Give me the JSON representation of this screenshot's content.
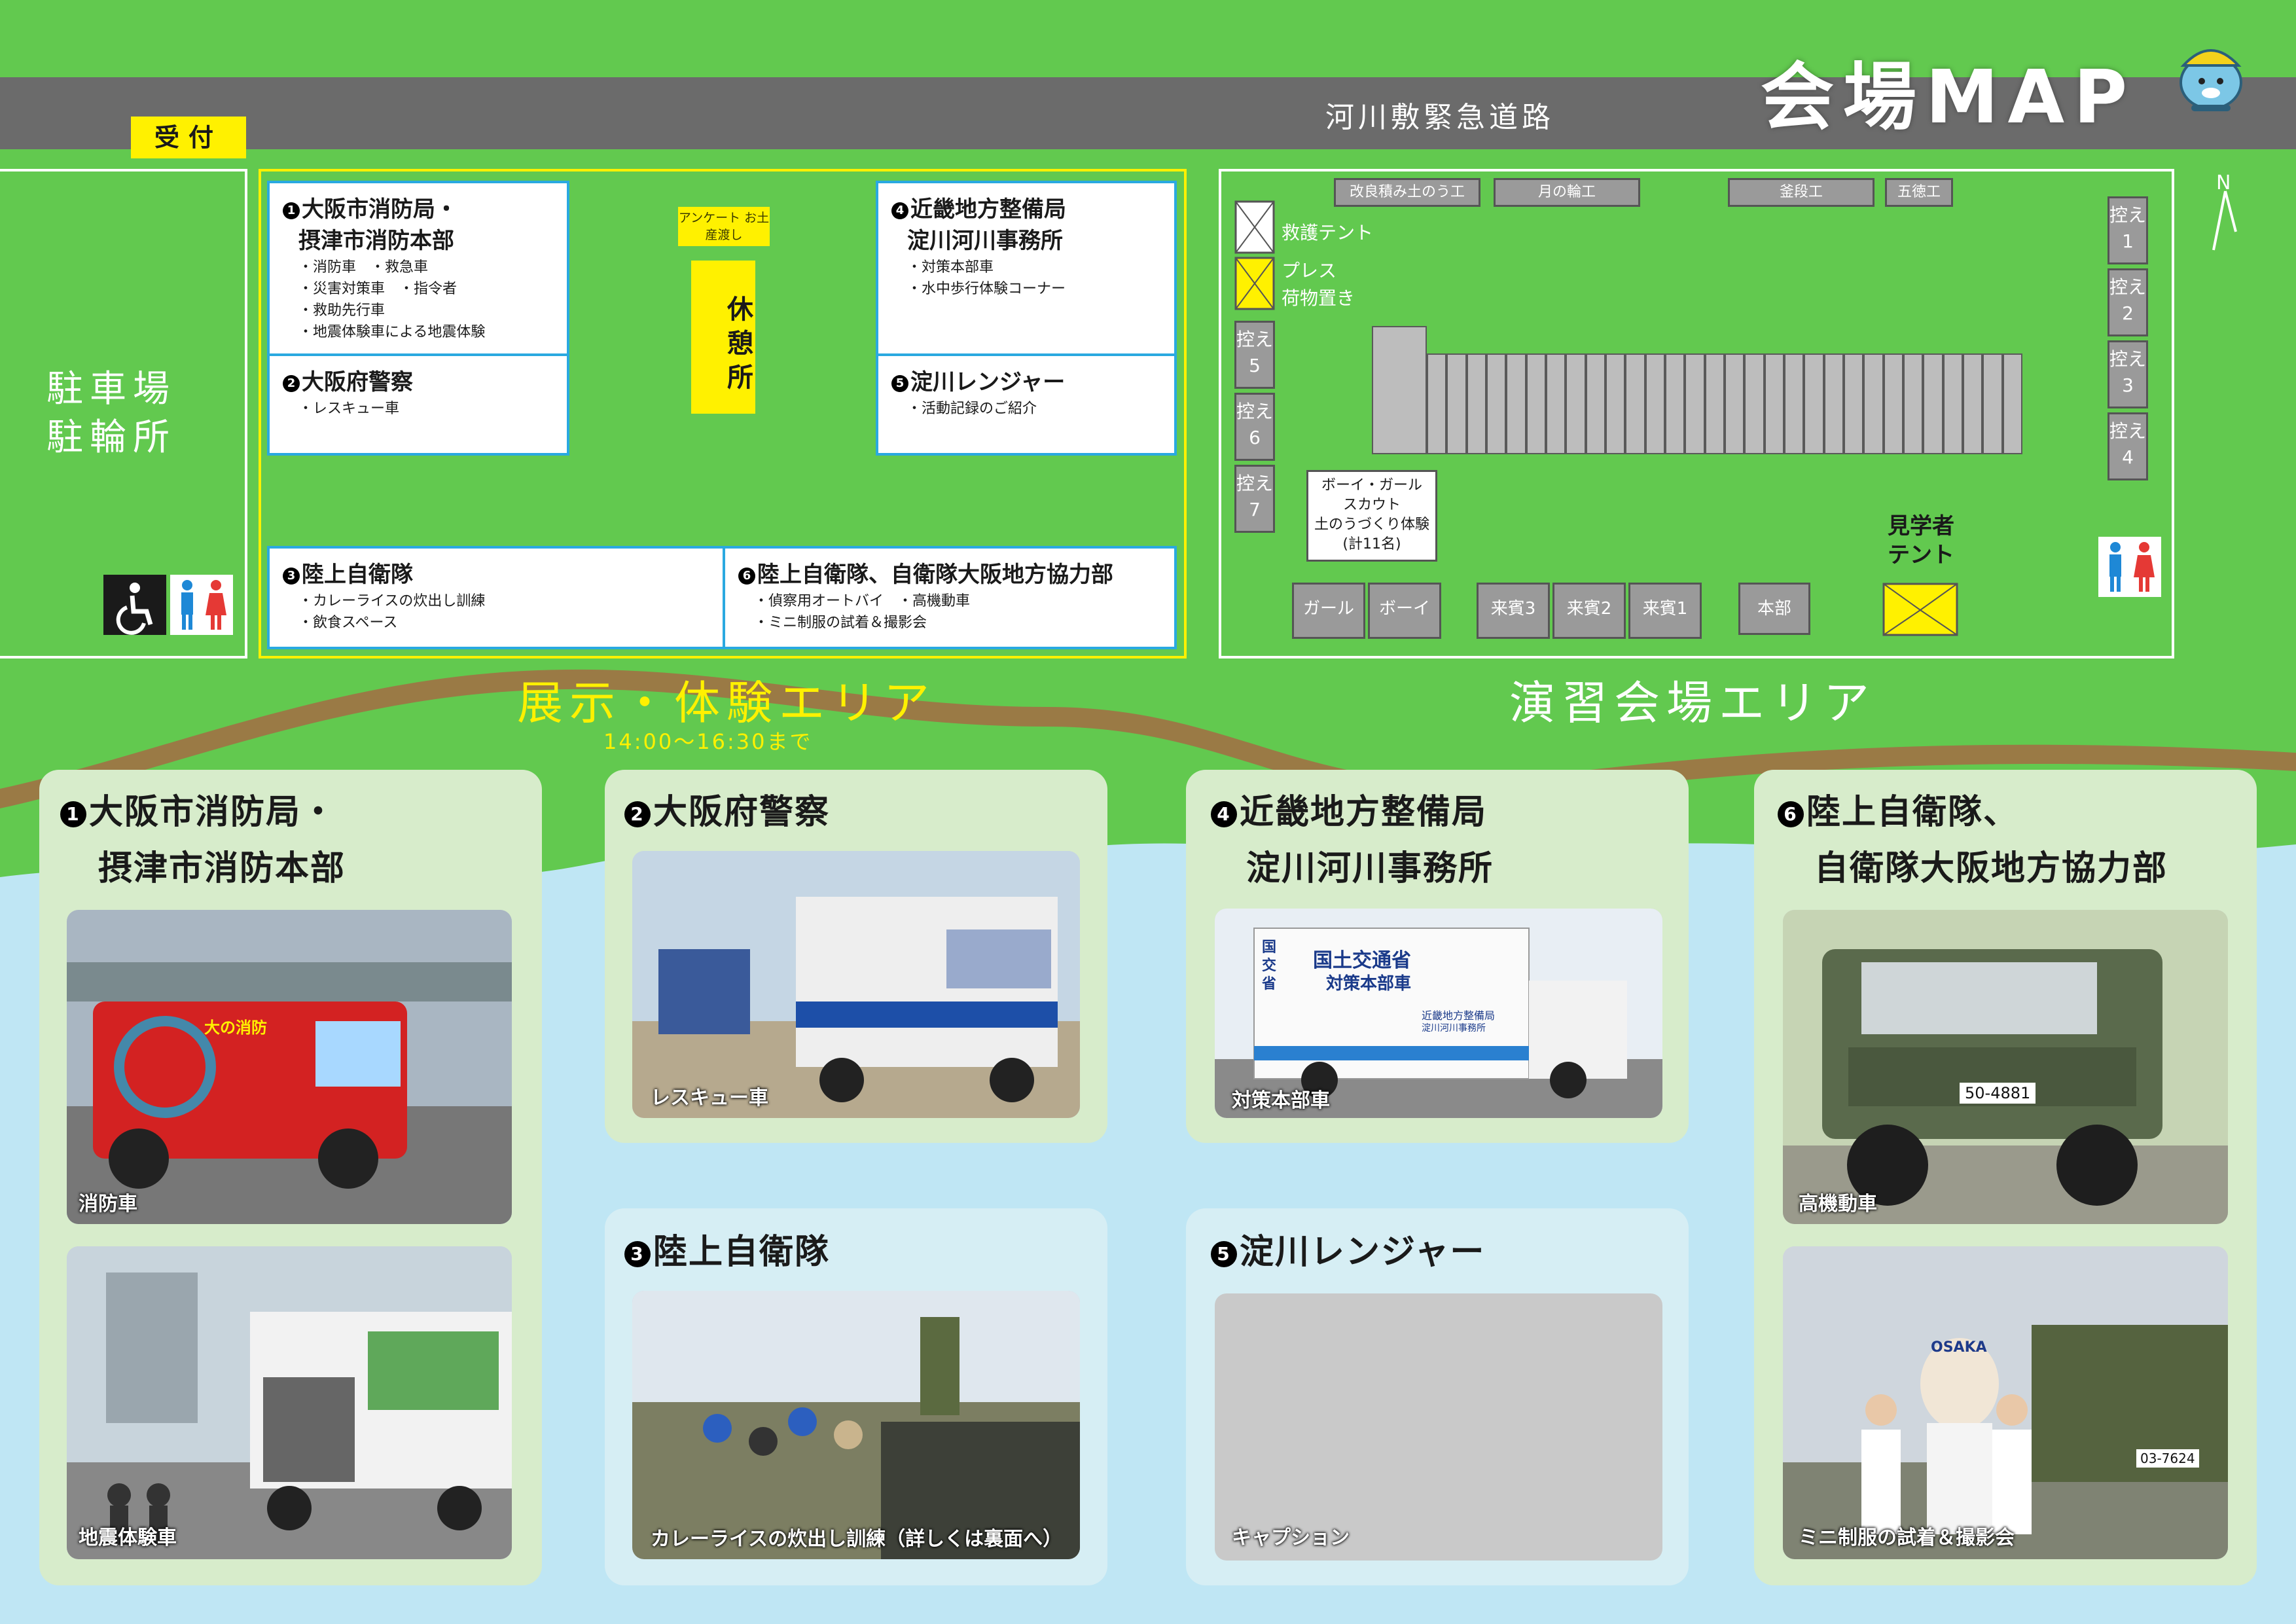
{
  "title": "会場MAP",
  "road": "河川敷緊急道路",
  "reception": "受付",
  "parking": {
    "line1": "駐車場",
    "line2": "駐輪所"
  },
  "compass": "N",
  "exhibit_area": {
    "title": "展示・体験エリア",
    "hours": "14:00〜16:30まで",
    "survey": "アンケート お土産渡し",
    "rest": "休憩所",
    "boxes": [
      {
        "num": "1",
        "name_l1": "大阪市消防局・",
        "name_l2": "摂津市消防本部",
        "details": [
          "・消防車　・救急車",
          "・災害対策車　・指令者",
          "・救助先行車",
          "・地震体験車による地震体験"
        ]
      },
      {
        "num": "2",
        "name_l1": "大阪府警察",
        "details": [
          "・レスキュー車"
        ]
      },
      {
        "num": "4",
        "name_l1": "近畿地方整備局",
        "name_l2": "淀川河川事務所",
        "details": [
          "・対策本部車",
          "・水中歩行体験コーナー"
        ]
      },
      {
        "num": "5",
        "name_l1": "淀川レンジャー",
        "details": [
          "・活動記録のご紹介"
        ]
      },
      {
        "num": "3",
        "name_l1": "陸上自衛隊",
        "details": [
          "・カレーライスの炊出し訓練",
          "・飲食スペース"
        ]
      },
      {
        "num": "6",
        "name_l1": "陸上自衛隊、自衛隊大阪地方協力部",
        "details": [
          "・偵察用オートバイ　・高機動車",
          "・ミニ制服の試着＆撮影会"
        ]
      }
    ]
  },
  "drill_area": {
    "title": "演習会場エリア",
    "top_labels": [
      "改良積み土のう工",
      "月の輪工",
      "釜段工",
      "五徳工"
    ],
    "rescue_tent": "救護テント",
    "press_l1": "プレス",
    "press_l2": "荷物置き",
    "ready_left": [
      "控え5",
      "控え6",
      "控え7"
    ],
    "ready_right": [
      "控え1",
      "控え2",
      "控え3",
      "控え4"
    ],
    "scout": {
      "l1": "ボーイ・ガール",
      "l2": "スカウト",
      "l3": "土のうづくり体験",
      "l4": "(計11名)"
    },
    "bottom_labels": [
      "ガール",
      "ボーイ",
      "来賓3",
      "来賓2",
      "来賓1",
      "本部"
    ],
    "visitor_tent": {
      "l1": "見学者",
      "l2": "テント"
    }
  },
  "cards": [
    {
      "num": "1",
      "title_l1": "大阪市消防局・",
      "title_l2": "摂津市消防本部",
      "captions": [
        "消防車",
        "地震体験車"
      ]
    },
    {
      "num": "2",
      "title_l1": "大阪府警察",
      "captions": [
        "レスキュー車"
      ]
    },
    {
      "num": "3",
      "title_l1": "陸上自衛隊",
      "captions": [
        "カレーライスの炊出し訓練（詳しくは裏面へ）"
      ]
    },
    {
      "num": "4",
      "title_l1": "近畿地方整備局",
      "title_l2": "淀川河川事務所",
      "captions": [
        "対策本部車"
      ]
    },
    {
      "num": "5",
      "title_l1": "淀川レンジャー",
      "captions": [
        "キャプション"
      ]
    },
    {
      "num": "6",
      "title_l1": "陸上自衛隊、",
      "title_l2": "自衛隊大阪地方協力部",
      "captions": [
        "高機動車",
        "ミニ制服の試着＆撮影会"
      ]
    }
  ],
  "photo_text": {
    "fire_truck_sign": "大の消防",
    "mlit_l1": "国土交通省",
    "mlit_l2": "対策本部車",
    "mlit_side": "国交省",
    "mlit_l3": "近畿地方整備局",
    "mlit_l4": "淀川河川事務所",
    "plate1": "50-4881",
    "plate2": "03-7624",
    "osaka": "OSAKA"
  },
  "colors": {
    "grass": "#62c94f",
    "water": "#bfe6f4",
    "road": "#6b6b6b",
    "path": "#9a7a45",
    "accent": "#fff100",
    "box_border": "#2aa9e0"
  }
}
